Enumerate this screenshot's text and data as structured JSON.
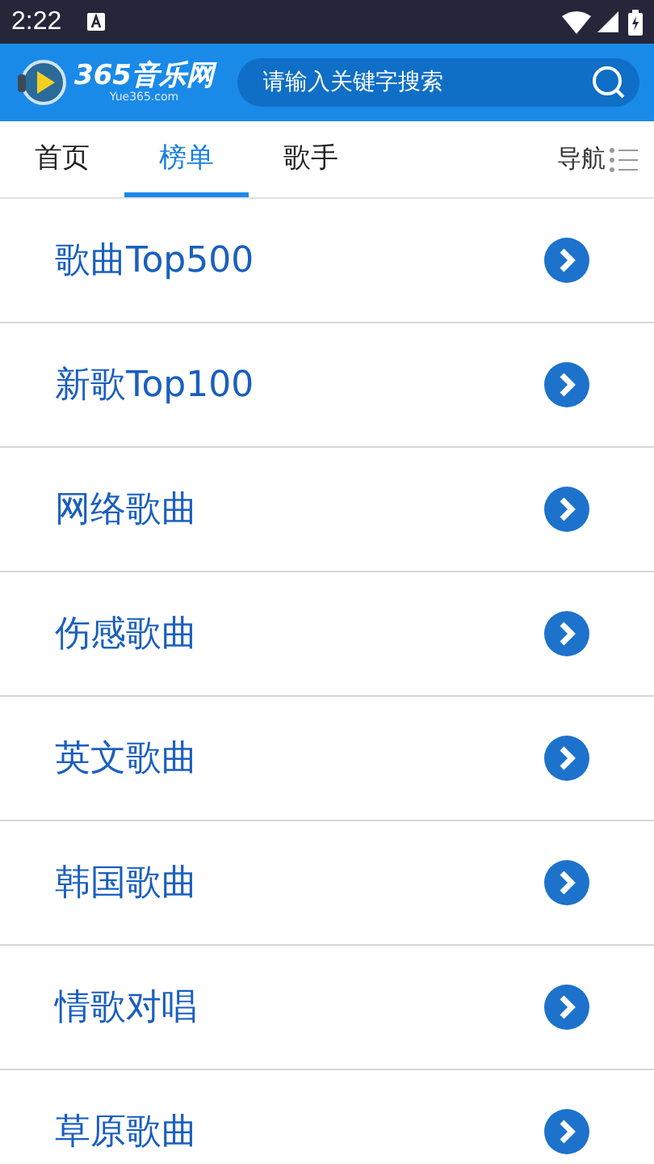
{
  "status_bar": {
    "time": "2:22"
  },
  "header": {
    "logo_text": "365音乐网",
    "logo_subtext": "Yue365.com",
    "search": {
      "placeholder": "请输入关键字搜索"
    }
  },
  "tabs": [
    {
      "label": "首页",
      "selected": false
    },
    {
      "label": "榜单",
      "selected": true
    },
    {
      "label": "歌手",
      "selected": false
    }
  ],
  "nav_label": "导航",
  "list": [
    {
      "title": "歌曲Top500"
    },
    {
      "title": "新歌Top100"
    },
    {
      "title": "网络歌曲"
    },
    {
      "title": "伤感歌曲"
    },
    {
      "title": "英文歌曲"
    },
    {
      "title": "韩国歌曲"
    },
    {
      "title": "情歌对唱"
    },
    {
      "title": "草原歌曲"
    }
  ]
}
